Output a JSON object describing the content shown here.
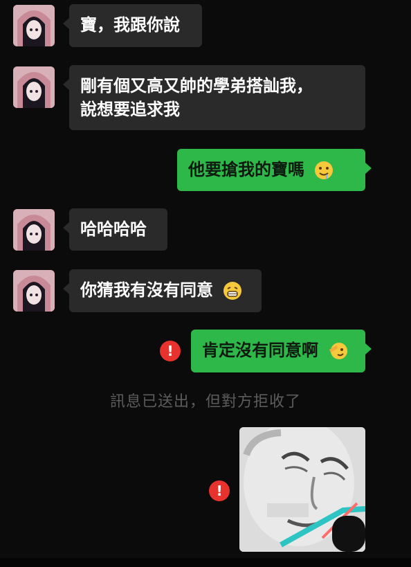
{
  "messages": [
    {
      "text": "寶，我跟你說"
    },
    {
      "line1": "剛有個又高又帥的學弟搭訕我，",
      "line2": "說想要追求我"
    },
    {
      "text": "他要搶我的寶嗎"
    },
    {
      "text": "哈哈哈哈"
    },
    {
      "text": "你猜我有沒有同意"
    },
    {
      "text": "肯定沒有同意啊"
    }
  ],
  "error_icon": "!",
  "notice": "訊息已送出，但對方拒收了",
  "icons": {
    "avatar": "anime-girl-avatar",
    "emoji_1": "drooling-face-emoji",
    "emoji_2": "grinning-face-emoji",
    "emoji_3": "salute-face-emoji",
    "error": "error-icon",
    "sticker": "meme-face-sticker"
  },
  "colors": {
    "background": "#0b0b0b",
    "incoming_bubble": "#2a2a2a",
    "outgoing_bubble": "#2fb84a",
    "error": "#e8322e",
    "notice_text": "#5c5c5c"
  }
}
